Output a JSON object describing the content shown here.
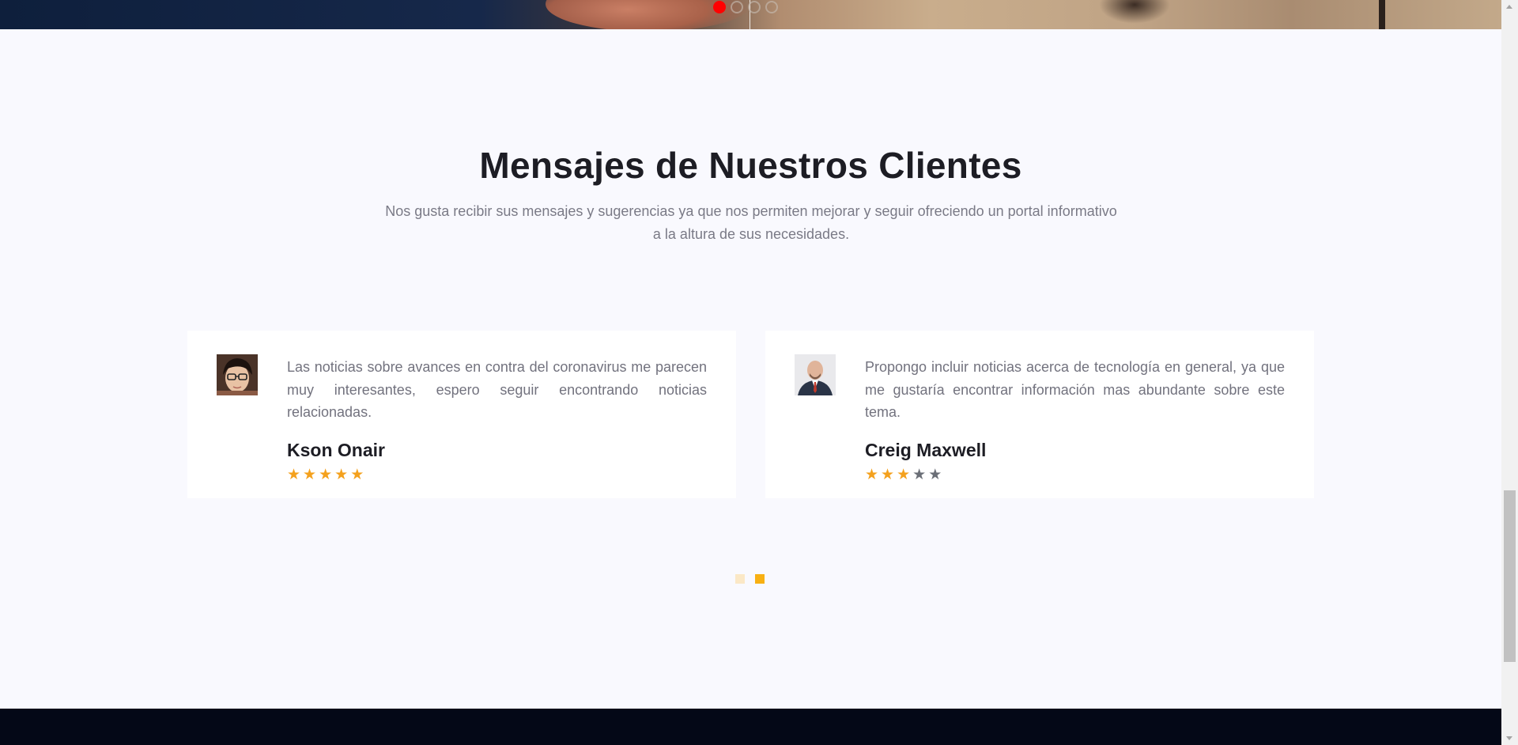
{
  "hero": {
    "slide_dots": 4,
    "active_slide": 1,
    "colors": {
      "active_dot": "#ff0000"
    }
  },
  "testimonials": {
    "title": "Mensajes de Nuestros Clientes",
    "subtitle": "Nos gusta recibir sus mensajes y sugerencias ya que nos permiten mejorar y seguir ofreciendo un portal informativo a la altura de sus necesidades.",
    "cards": [
      {
        "avatar_icon": "avatar-woman-glasses",
        "quote": "Las noticias sobre avances en contra del coronavirus me parecen muy interesantes, espero seguir encontrando noticias relacionadas.",
        "author": "Kson Onair",
        "rating": 5,
        "max_rating": 5
      },
      {
        "avatar_icon": "avatar-bald-man",
        "quote": "Propongo incluir noticias acerca de tecnología en general, ya que me gustaría encontrar información mas abundante sobre este tema.",
        "author": "Creig Maxwell",
        "rating": 3,
        "max_rating": 5
      }
    ],
    "pager": {
      "pages": 2,
      "active_page": 2
    }
  },
  "colors": {
    "star_filled": "#f4a11d",
    "star_empty": "#6b6f77",
    "pager_active": "#f8b013",
    "pager_inactive": "#fbe8c6",
    "footer_bg": "#040817",
    "section_bg": "#f9f9fe"
  }
}
